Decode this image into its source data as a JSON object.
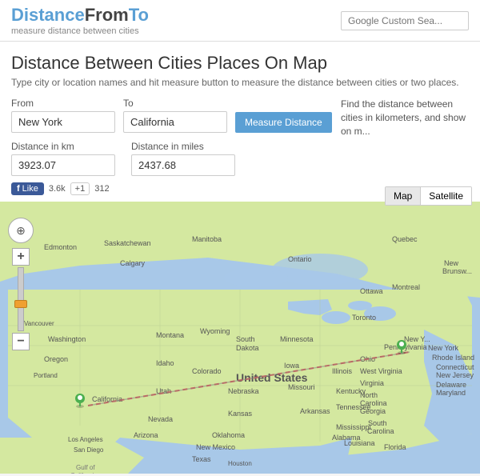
{
  "header": {
    "logo_distance": "Distance",
    "logo_from": "From",
    "logo_to": "To",
    "logo_tagline": "measure distance between cities",
    "search_placeholder": "Google Custom Sea..."
  },
  "page": {
    "title": "Distance Between Cities Places On Map",
    "subtitle": "Type city or location names and hit measure button to measure the distance between cities or two places.",
    "right_panel_text": "Find the distance between cities in kilometers, and show on m..."
  },
  "form": {
    "from_label": "From",
    "from_value": "New York",
    "to_label": "To",
    "to_value": "California",
    "measure_btn": "Measure Distance",
    "dist_km_label": "Distance in km",
    "dist_km_value": "3923.07",
    "dist_miles_label": "Distance in miles",
    "dist_miles_value": "2437.68"
  },
  "social": {
    "like_label": "Like",
    "like_count": "3.6k",
    "gplus_label": "+1",
    "gplus_count": "312"
  },
  "map": {
    "map_btn": "Map",
    "satellite_btn": "Satellite"
  },
  "zoom": {
    "zoom_in": "+",
    "zoom_out": "−"
  }
}
